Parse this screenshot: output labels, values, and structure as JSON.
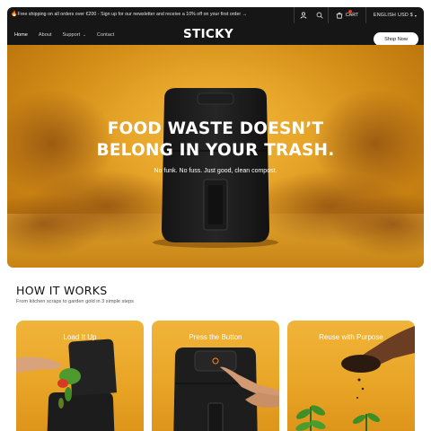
{
  "announcement": "Free shipping on all orders over €200 - Sign up for our newsletter and receive a 10% off on your first order →",
  "utility": {
    "cart_label": "CART",
    "language_label": "ENGLISH",
    "currency_label": "USD $"
  },
  "nav": {
    "links": [
      "Home",
      "About",
      "Support",
      "Contact"
    ],
    "logo": "STICKY",
    "cta": "Shop Now"
  },
  "hero": {
    "title_line1": "FOOD WASTE DOESN’T",
    "title_line2": "BELONG IN YOUR TRASH.",
    "subtitle": "No funk. No fuss. Just good, clean compost."
  },
  "how": {
    "title": "HOW IT WORKS",
    "subtitle": "From kitchen scraps to garden gold in 3 simple steps",
    "steps": [
      "Load It Up",
      "Press the Button",
      "Reuse with Purpose"
    ]
  },
  "icons": [
    "flame-icon",
    "user-icon",
    "search-icon",
    "cart-icon",
    "chevron-down-icon"
  ],
  "colors": {
    "dark": "#161616",
    "accent": "#e9a526",
    "badge": "#e63a1e"
  }
}
